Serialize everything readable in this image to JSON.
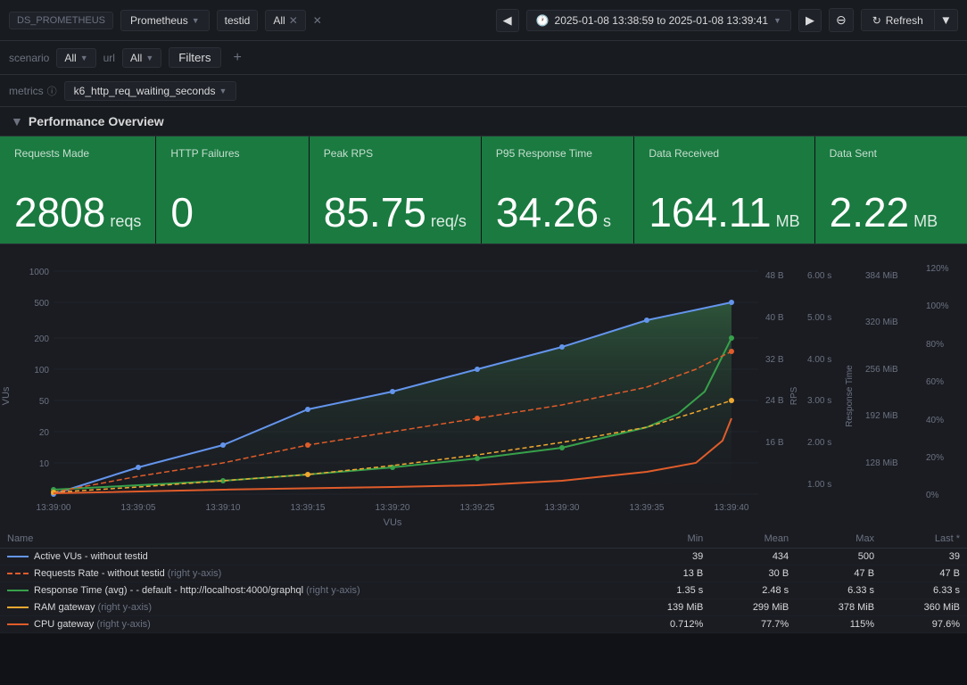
{
  "topbar": {
    "ds_label": "DS_PROMETHEUS",
    "datasource": "Prometheus",
    "testid_label": "testid",
    "filter_all": "All",
    "time_range": "2025-01-08 13:38:59 to 2025-01-08 13:39:41",
    "refresh_label": "Refresh"
  },
  "filterbar": {
    "scenario_label": "scenario",
    "scenario_value": "All",
    "url_label": "url",
    "url_value": "All",
    "filters_label": "Filters"
  },
  "metricsbar": {
    "metrics_label": "metrics",
    "metrics_value": "k6_http_req_waiting_seconds"
  },
  "section": {
    "title": "Performance Overview"
  },
  "stats": [
    {
      "title": "Requests Made",
      "value": "2808",
      "unit": "reqs"
    },
    {
      "title": "HTTP Failures",
      "value": "0",
      "unit": ""
    },
    {
      "title": "Peak RPS",
      "value": "85.75",
      "unit": "req/s"
    },
    {
      "title": "P95 Response Time",
      "value": "34.26",
      "unit": "s"
    },
    {
      "title": "Data Received",
      "value": "164.11",
      "unit": "MB"
    },
    {
      "title": "Data Sent",
      "value": "2.22",
      "unit": "MB"
    }
  ],
  "chart": {
    "y_left_labels": [
      "1000",
      "500",
      "200",
      "100",
      "50",
      "20",
      "10"
    ],
    "x_labels": [
      "13:39:00",
      "13:39:05",
      "13:39:10",
      "13:39:15",
      "13:39:20",
      "13:39:25",
      "13:39:30",
      "13:39:35",
      "13:39:40"
    ],
    "x_axis_label": "VUs",
    "y_right_rps_labels": [
      "48 B",
      "40 B",
      "32 B",
      "24 B",
      "16 B"
    ],
    "y_right_rt_labels": [
      "6.00 s",
      "5.00 s",
      "4.00 s",
      "3.00 s",
      "2.00 s",
      "1.00 s"
    ],
    "y_right_mib_labels": [
      "384 MiB",
      "320 MiB",
      "256 MiB",
      "192 MiB",
      "128 MiB"
    ],
    "y_right_pct_labels": [
      "120%",
      "100%",
      "80%",
      "60%",
      "40%",
      "20%",
      "0%"
    ]
  },
  "legend": {
    "col_name": "Name",
    "col_min": "Min",
    "col_mean": "Mean",
    "col_max": "Max",
    "col_last": "Last *",
    "rows": [
      {
        "color": "#6495ed",
        "style": "solid",
        "name": "Active VUs - without testid",
        "sub": "",
        "min": "39",
        "mean": "434",
        "max": "500",
        "last": "39"
      },
      {
        "color": "#e05c2a",
        "style": "dashed",
        "name": "Requests Rate - without testid",
        "sub": "(right y-axis)",
        "min": "13 B",
        "mean": "30 B",
        "max": "47 B",
        "last": "47 B"
      },
      {
        "color": "#37a14a",
        "style": "solid",
        "name": "Response Time (avg) - - default - http://localhost:4000/graphql",
        "sub": "(right y-axis)",
        "min": "1.35 s",
        "mean": "2.48 s",
        "max": "6.33 s",
        "last": "6.33 s"
      },
      {
        "color": "#f0a830",
        "style": "solid",
        "name": "RAM gateway",
        "sub": "(right y-axis)",
        "min": "139 MiB",
        "mean": "299 MiB",
        "max": "378 MiB",
        "last": "360 MiB"
      },
      {
        "color": "#e05c2a",
        "style": "solid",
        "name": "CPU gateway",
        "sub": "(right y-axis)",
        "min": "0.712%",
        "mean": "77.7%",
        "max": "115%",
        "last": "97.6%"
      }
    ]
  }
}
